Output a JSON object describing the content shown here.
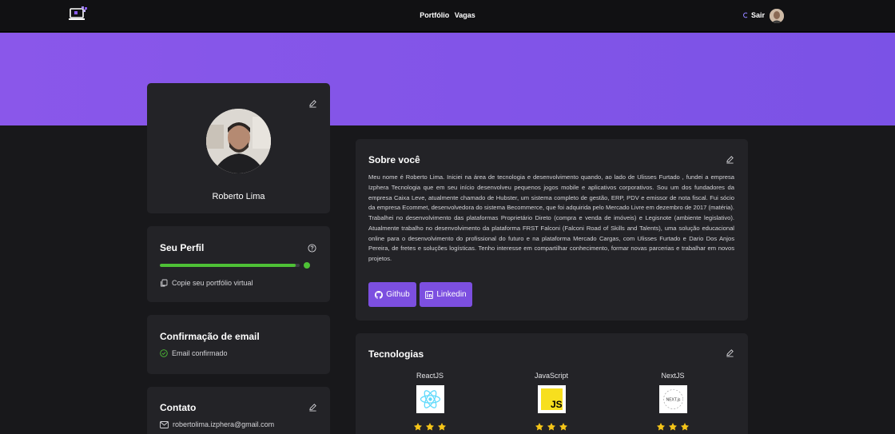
{
  "header": {
    "nav": [
      "Portfólio",
      "Vagas"
    ],
    "logout_label": "Sair"
  },
  "profile": {
    "name": "Roberto Lima"
  },
  "perfil": {
    "title": "Seu Perfil",
    "progress_fraction": 0.97,
    "copy_label": "Copie seu portfólio virtual"
  },
  "email": {
    "title": "Confirmação de email",
    "status": "Email confirmado"
  },
  "contato": {
    "title": "Contato",
    "email": "robertolima.izphera@gmail.com"
  },
  "about": {
    "title": "Sobre você",
    "text": "Meu nome é Roberto Lima. Iniciei na área de tecnologia e desenvolvimento quando, ao lado de Ulisses Furtado , fundei a empresa Izphera Tecnologia que em seu início desenvolveu pequenos jogos mobile e aplicativos corporativos. Sou um dos fundadores da empresa Caixa Leve, atualmente chamado de Hubster, um sistema completo de gestão, ERP, PDV e emissor de nota fiscal. Fui sócio da empresa Ecommet, desenvolvedora do sistema Becommerce, que foi adquirida pelo Mercado Livre em dezembro de 2017 (matéria). Trabalhei no desenvolvimento das plataformas Proprietário Direto (compra e venda de imóveis) e Legisnote (ambiente legislativo). Atualmente trabalho no desenvolvimento da plataforma FRST Falconi (Falconi Road of Skills and Talents), uma solução educacional online para o desenvolvimento do profissional do futuro e na plataforma Mercado Cargas, com Ulisses Furtado e Dario Dos Anjos Pereira, de fretes e soluções logísticas. Tenho interesse em compartilhar conhecimento, formar novas parcerias e trabalhar em novos projetos.",
    "github_label": "Github",
    "linkedin_label": "Linkedin"
  },
  "tecnologias": {
    "title": "Tecnologias",
    "items": [
      {
        "name": "ReactJS",
        "stars": 3
      },
      {
        "name": "JavaScript",
        "logo_text": "JS",
        "stars": 3
      },
      {
        "name": "NextJS",
        "logo_text": "NEXT.js",
        "stars": 3
      }
    ]
  },
  "colors": {
    "accent": "#7c4fe0",
    "banner": "#8a57ea",
    "success": "#4ec136",
    "card": "#232327",
    "background": "#18181b",
    "star": "#f5c518"
  }
}
